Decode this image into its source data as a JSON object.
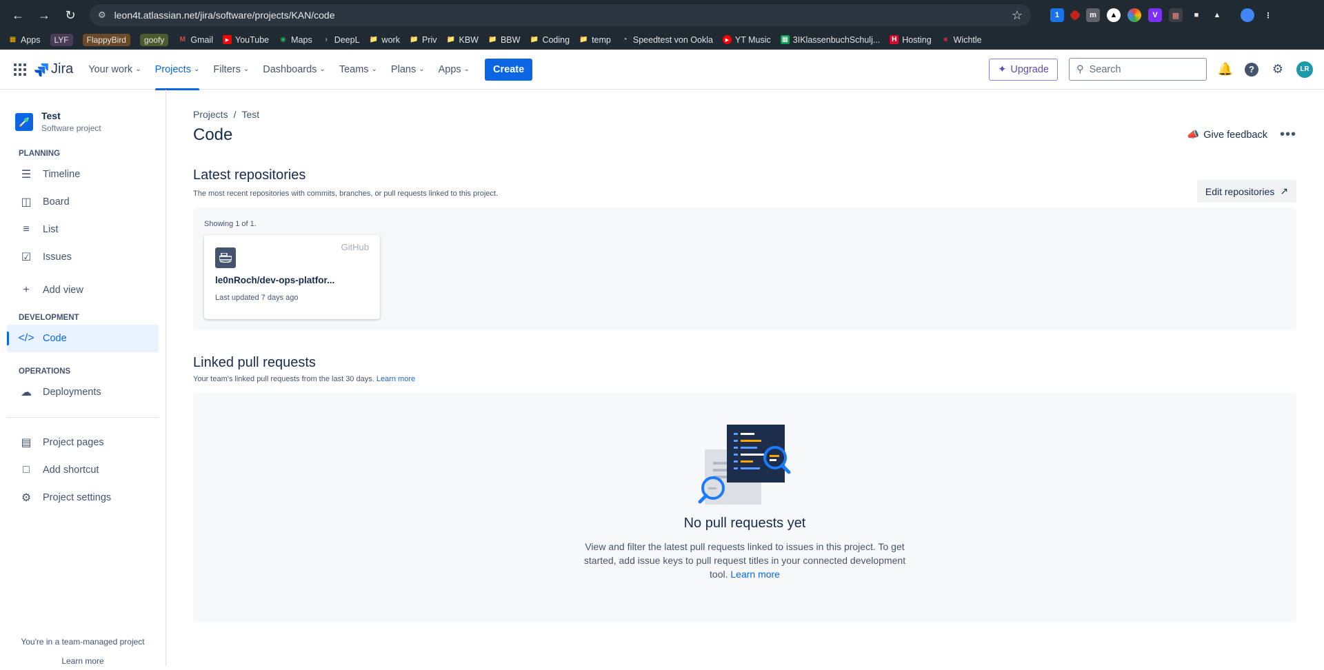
{
  "browser": {
    "url": "leon4t.atlassian.net/jira/software/projects/KAN/code",
    "bookmarks": [
      "Apps",
      "LYF",
      "FlappyBird",
      "goofy",
      "Gmail",
      "YouTube",
      "Maps",
      "DeepL",
      "work",
      "Priv",
      "KBW",
      "BBW",
      "Coding",
      "temp",
      "Speedtest von Ookla",
      "YT Music",
      "3IKlassenbuchSchulj...",
      "Hosting",
      "Wichtle"
    ]
  },
  "nav": {
    "product": "Jira",
    "items": [
      "Your work",
      "Projects",
      "Filters",
      "Dashboards",
      "Teams",
      "Plans",
      "Apps"
    ],
    "create": "Create",
    "upgrade": "Upgrade",
    "search_placeholder": "Search",
    "avatar_initials": "LR"
  },
  "sidebar": {
    "project_name": "Test",
    "project_type": "Software project",
    "planning_label": "PLANNING",
    "planning_items": [
      "Timeline",
      "Board",
      "List",
      "Issues",
      "Add view"
    ],
    "development_label": "DEVELOPMENT",
    "development_items": [
      "Code"
    ],
    "operations_label": "OPERATIONS",
    "operations_items": [
      "Deployments"
    ],
    "bottom_items": [
      "Project pages",
      "Add shortcut",
      "Project settings"
    ],
    "footer_text": "You're in a team-managed project",
    "footer_link": "Learn more"
  },
  "main": {
    "breadcrumbs": [
      "Projects",
      "/",
      "Test"
    ],
    "title": "Code",
    "feedback": "Give feedback",
    "repos": {
      "title": "Latest repositories",
      "desc": "The most recent repositories with commits, branches, or pull requests linked to this project.",
      "edit": "Edit repositories",
      "showing": "Showing 1 of 1.",
      "card": {
        "provider": "GitHub",
        "name": "le0nRoch/dev-ops-platfor...",
        "updated": "Last updated 7 days ago"
      }
    },
    "prs": {
      "title": "Linked pull requests",
      "desc": "Your team's linked pull requests from the last 30 days.",
      "desc_link": "Learn more",
      "empty_title": "No pull requests yet",
      "empty_desc": "View and filter the latest pull requests linked to issues in this project. To get started, add issue keys to pull request titles in your connected development tool.",
      "empty_link": "Learn more"
    }
  },
  "colors": {
    "accent": "#0c66e4",
    "chrome": "#1f2a33"
  }
}
